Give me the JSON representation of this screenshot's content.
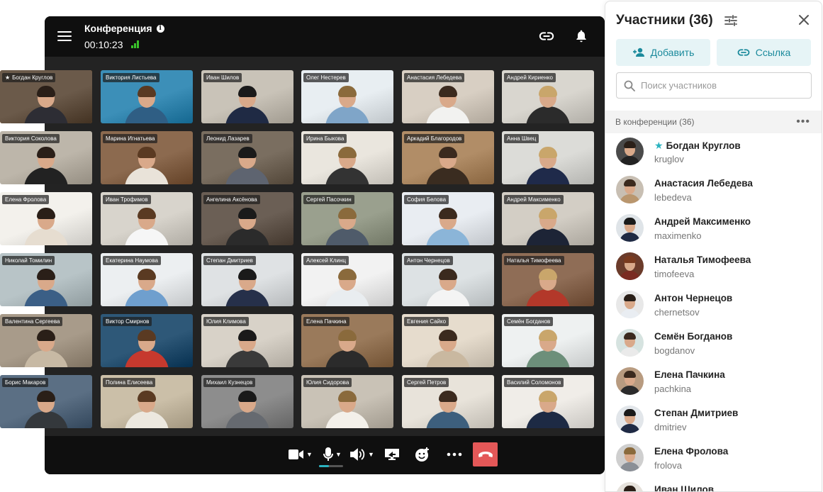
{
  "header": {
    "title": "Конференция",
    "timer": "00:10:23"
  },
  "panel": {
    "title": "Участники (36)",
    "add_label": "Добавить",
    "link_label": "Ссылка",
    "search_placeholder": "Поиск участников",
    "section_label": "В конференции (36)",
    "participants": [
      {
        "name": "Богдан Круглов",
        "login": "kruglov",
        "host": true
      },
      {
        "name": "Анастасия Лебедева",
        "login": "lebedeva"
      },
      {
        "name": "Андрей Максименко",
        "login": "maximenko"
      },
      {
        "name": "Наталья Тимофеева",
        "login": "timofeeva"
      },
      {
        "name": "Антон Чернецов",
        "login": "chernetsov"
      },
      {
        "name": "Семён Богданов",
        "login": "bogdanov"
      },
      {
        "name": "Елена Пачкина",
        "login": "pachkina"
      },
      {
        "name": "Степан Дмитриев",
        "login": "dmitriev"
      },
      {
        "name": "Елена Фролова",
        "login": "frolova"
      },
      {
        "name": "Иван Шилов",
        "login": ""
      }
    ]
  },
  "tiles": [
    {
      "name": "Богдан Круглов",
      "host": true,
      "active": true
    },
    {
      "name": "Виктория Листьева"
    },
    {
      "name": "Иван Шилов"
    },
    {
      "name": "Олег Нестерев"
    },
    {
      "name": "Анастасия Лебедева"
    },
    {
      "name": "Андрей Кириенко"
    },
    {
      "name": "Виктория Соколова"
    },
    {
      "name": "Марина Игнатьева"
    },
    {
      "name": "Леонид Лазарев"
    },
    {
      "name": "Ирина Быкова"
    },
    {
      "name": "Аркадий Благородов"
    },
    {
      "name": "Анна Швец"
    },
    {
      "name": "Елена Фролова"
    },
    {
      "name": "Иван Трофимов"
    },
    {
      "name": "Ангелина Аксёнова"
    },
    {
      "name": "Сергей Пасочкин"
    },
    {
      "name": "София Белова",
      "active": true
    },
    {
      "name": "Андрей Максименко"
    },
    {
      "name": "Николай Томилин"
    },
    {
      "name": "Екатерина Наумова"
    },
    {
      "name": "Степан Дмитриев"
    },
    {
      "name": "Алексей Клинц"
    },
    {
      "name": "Антон Чернецов"
    },
    {
      "name": "Наталья Тимофеева"
    },
    {
      "name": "Валентина Сергеева"
    },
    {
      "name": "Виктор Смирнов"
    },
    {
      "name": "Юлия Климова"
    },
    {
      "name": "Елена Пачкина"
    },
    {
      "name": "Евгения Сайко"
    },
    {
      "name": "Семён Богданов"
    },
    {
      "name": "Борис Макаров"
    },
    {
      "name": "Полина Елисеева"
    },
    {
      "name": "Михаил Кузнецов"
    },
    {
      "name": "Юлия Сидорова"
    },
    {
      "name": "Сергей Петров"
    },
    {
      "name": "Василий Соломонов"
    }
  ],
  "colors": {
    "accent": "#2bb3c0",
    "hangup": "#e45858",
    "active_border": "#f08a2a",
    "signal": "#39c12a"
  }
}
